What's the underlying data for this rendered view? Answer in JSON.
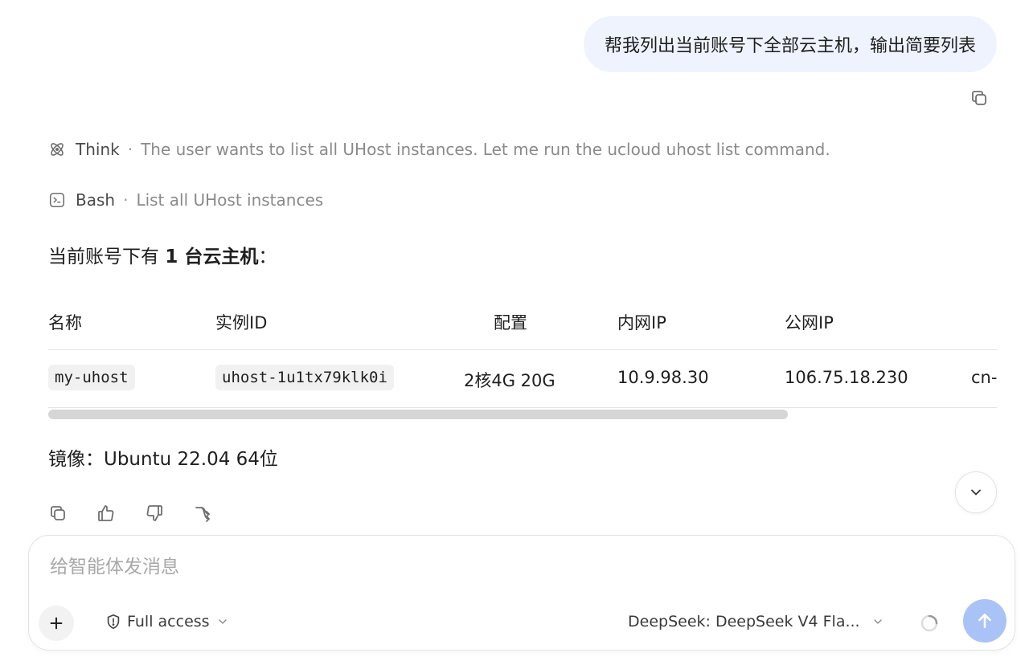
{
  "user_message": {
    "text": "帮我列出当前账号下全部云主机，输出简要列表"
  },
  "steps": [
    {
      "label": "Think",
      "description": "The user wants to list all UHost instances. Let me run the ucloud uhost list command."
    },
    {
      "label": "Bash",
      "description": "List all UHost instances"
    }
  ],
  "separator": "·",
  "answer": {
    "intro_prefix": "当前账号下有 ",
    "intro_bold": "1 台云主机",
    "intro_suffix": "：",
    "table": {
      "headers": [
        "名称",
        "实例ID",
        "配置",
        "内网IP",
        "公网IP"
      ],
      "row": {
        "name": "my-uhost",
        "instance_id": "uhost-1u1tx79klk0i",
        "config": "2核4G 20G",
        "private_ip": "10.9.98.30",
        "public_ip": "106.75.18.230",
        "truncated": "cn-"
      }
    },
    "image_label": "镜像：",
    "image_value": "Ubuntu 22.04 64位"
  },
  "composer": {
    "placeholder": "给智能体发消息",
    "access_label": "Full access",
    "model_label": "DeepSeek: DeepSeek V4 Fla..."
  },
  "colors": {
    "bubble_bg": "#eef3fd",
    "send_button": "#a9c3f6"
  }
}
